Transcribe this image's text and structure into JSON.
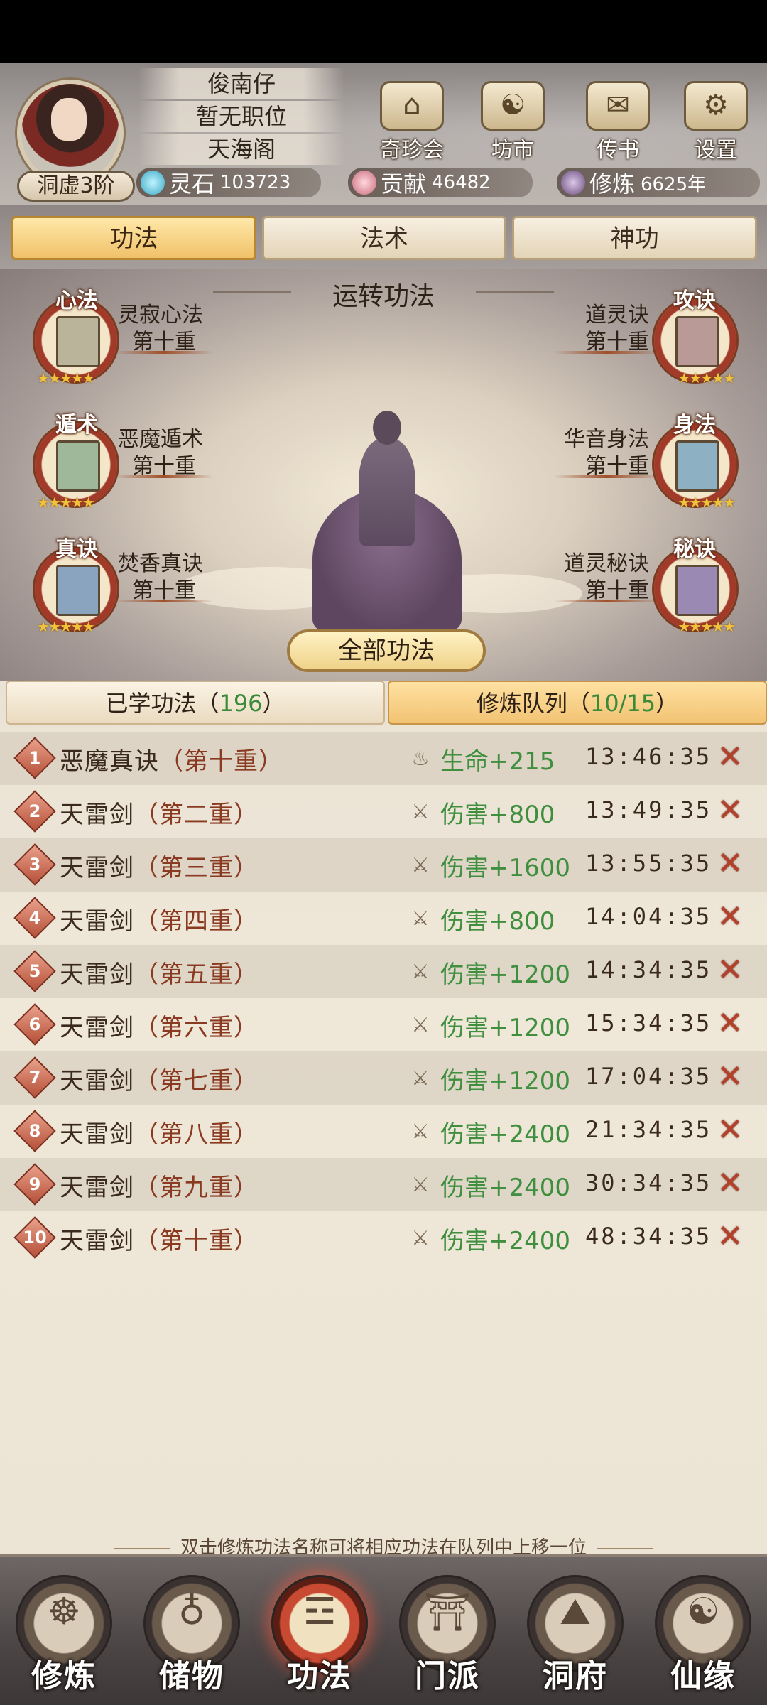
{
  "player": {
    "name": "俊南仔",
    "position": "暂无职位",
    "sect": "天海阁",
    "rank": "洞虚3阶"
  },
  "top_menu": [
    {
      "label": "奇珍会",
      "icon": "treasure-pavilion-icon"
    },
    {
      "label": "坊市",
      "icon": "market-icon"
    },
    {
      "label": "传书",
      "icon": "scroll-letter-icon"
    },
    {
      "label": "设置",
      "icon": "gear-icon"
    }
  ],
  "resources": {
    "spirit_stone": {
      "label": "灵石",
      "value": "103723"
    },
    "contribution": {
      "label": "贡献",
      "value": "46482"
    },
    "cultivation": {
      "label": "修炼",
      "value": "6625年"
    }
  },
  "tabs": [
    {
      "label": "功法",
      "active": true
    },
    {
      "label": "法术",
      "active": false
    },
    {
      "label": "神功",
      "active": false
    }
  ],
  "stage": {
    "title": "运转功法",
    "all_button": "全部功法",
    "left_skills": [
      {
        "category": "心法",
        "name": "灵寂心法",
        "level": "第十重",
        "stars": "★★★★★"
      },
      {
        "category": "遁术",
        "name": "恶魔遁术",
        "level": "第十重",
        "stars": "★★★★★"
      },
      {
        "category": "真诀",
        "name": "焚香真诀",
        "level": "第十重",
        "stars": "★★★★★"
      }
    ],
    "right_skills": [
      {
        "category": "攻诀",
        "name": "道灵诀",
        "level": "第十重",
        "stars": "★★★★★"
      },
      {
        "category": "身法",
        "name": "华音身法",
        "level": "第十重",
        "stars": "★★★★★"
      },
      {
        "category": "秘诀",
        "name": "道灵秘诀",
        "level": "第十重",
        "stars": "★★★★★"
      }
    ]
  },
  "list_tabs": {
    "learned": {
      "label": "已学功法（",
      "count": "196",
      "suffix": "）"
    },
    "queue": {
      "label": "修炼队列（",
      "count": "10/15",
      "suffix": "）"
    }
  },
  "queue": [
    {
      "index": "1",
      "name": "恶魔真诀",
      "level": "（第十重）",
      "effect_icon": "life-icon",
      "effect": "生命+215",
      "time": "13:46:35"
    },
    {
      "index": "2",
      "name": "天雷剑",
      "level": "（第二重）",
      "effect_icon": "damage-icon",
      "effect": "伤害+800",
      "time": "13:49:35"
    },
    {
      "index": "3",
      "name": "天雷剑",
      "level": "（第三重）",
      "effect_icon": "damage-icon",
      "effect": "伤害+1600",
      "time": "13:55:35"
    },
    {
      "index": "4",
      "name": "天雷剑",
      "level": "（第四重）",
      "effect_icon": "damage-icon",
      "effect": "伤害+800",
      "time": "14:04:35"
    },
    {
      "index": "5",
      "name": "天雷剑",
      "level": "（第五重）",
      "effect_icon": "damage-icon",
      "effect": "伤害+1200",
      "time": "14:34:35"
    },
    {
      "index": "6",
      "name": "天雷剑",
      "level": "（第六重）",
      "effect_icon": "damage-icon",
      "effect": "伤害+1200",
      "time": "15:34:35"
    },
    {
      "index": "7",
      "name": "天雷剑",
      "level": "（第七重）",
      "effect_icon": "damage-icon",
      "effect": "伤害+1200",
      "time": "17:04:35"
    },
    {
      "index": "8",
      "name": "天雷剑",
      "level": "（第八重）",
      "effect_icon": "damage-icon",
      "effect": "伤害+2400",
      "time": "21:34:35"
    },
    {
      "index": "9",
      "name": "天雷剑",
      "level": "（第九重）",
      "effect_icon": "damage-icon",
      "effect": "伤害+2400",
      "time": "30:34:35"
    },
    {
      "index": "10",
      "name": "天雷剑",
      "level": "（第十重）",
      "effect_icon": "damage-icon",
      "effect": "伤害+2400",
      "time": "48:34:35"
    }
  ],
  "hint": "双击修炼功法名称可将相应功法在队列中上移一位",
  "bottom_nav": [
    {
      "label": "修炼",
      "icon": "cultivate-icon",
      "active": false
    },
    {
      "label": "储物",
      "icon": "storage-bag-icon",
      "active": false
    },
    {
      "label": "功法",
      "icon": "technique-scroll-icon",
      "active": true
    },
    {
      "label": "门派",
      "icon": "sect-gate-icon",
      "active": false
    },
    {
      "label": "洞府",
      "icon": "cave-abode-icon",
      "active": false
    },
    {
      "label": "仙缘",
      "icon": "immortal-fate-icon",
      "active": false
    }
  ],
  "colors": {
    "effect_green": "#3f8f3f",
    "delete_red": "#b2402a",
    "active_tab": "#f0c16a"
  }
}
